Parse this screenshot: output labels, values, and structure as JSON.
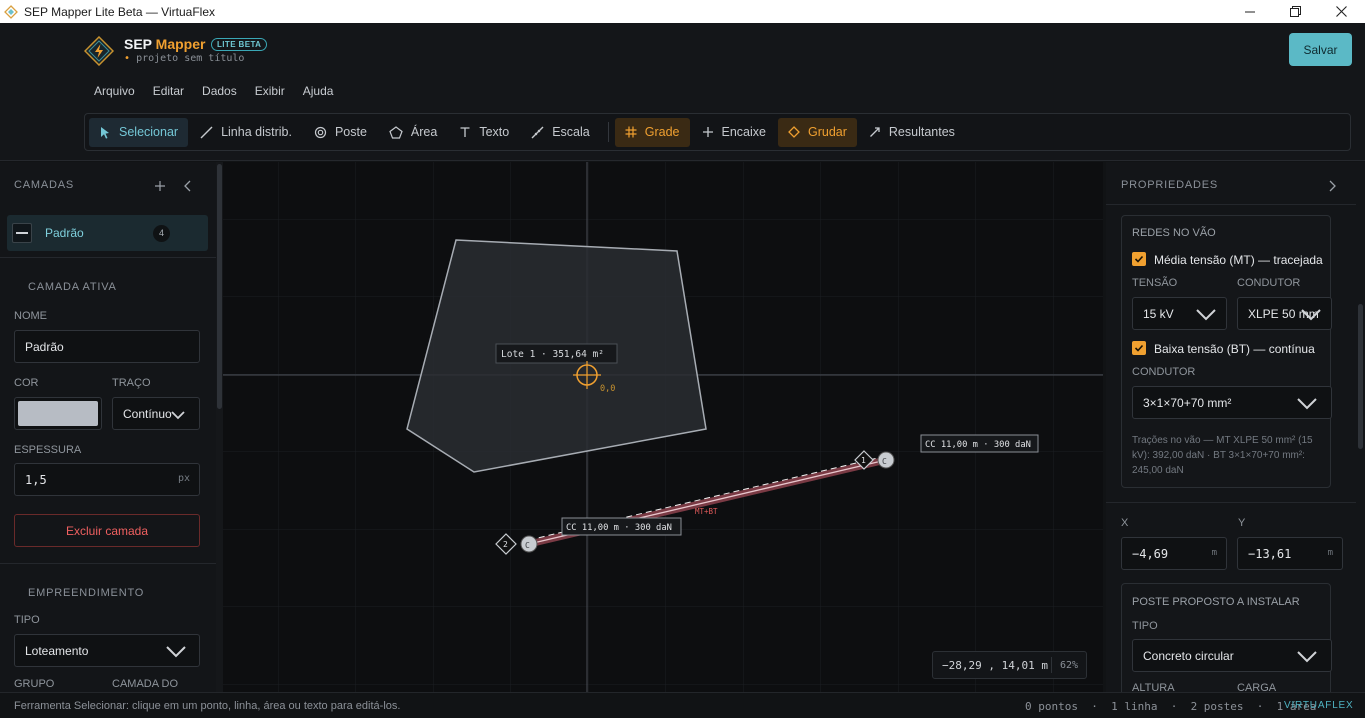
{
  "window": {
    "title": "SEP Mapper Lite Beta — VirtuaFlex"
  },
  "app": {
    "brand_main": "SEP",
    "brand_accent": "Mapper",
    "badge": "LITE BETA",
    "project_dot": "•",
    "project": "projeto sem título",
    "save_label": "Salvar",
    "accent_color": "#5bb9c6",
    "highlight_color": "#f0a030"
  },
  "menu": [
    "Arquivo",
    "Editar",
    "Dados",
    "Exibir",
    "Ajuda"
  ],
  "toolbar": {
    "select": "Selecionar",
    "line": "Linha distrib.",
    "pole": "Poste",
    "area": "Área",
    "text": "Texto",
    "scale": "Escala",
    "grid": "Grade",
    "snap": "Encaixe",
    "glue": "Grudar",
    "resultants": "Resultantes"
  },
  "layers": {
    "title": "CAMADAS",
    "items": [
      {
        "name": "Padrão",
        "count": "4"
      }
    ]
  },
  "active_layer": {
    "title": "CAMADA ATIVA",
    "name_label": "NOME",
    "name_value": "Padrão",
    "color_label": "COR",
    "color_value": "#b7bcc4",
    "stroke_label": "TRAÇO",
    "stroke_value": "Contínuo",
    "thickness_label": "ESPESSURA",
    "thickness_value": "1,5",
    "thickness_unit": "px",
    "delete_label": "Excluir camada"
  },
  "venture": {
    "title": "EMPREENDIMENTO",
    "type_label": "TIPO",
    "type_value": "Loteamento",
    "group_label": "GRUPO",
    "layer_label": "CAMADA DO"
  },
  "canvas": {
    "area_label": "Lote 1 · 351,64 m²",
    "origin_label": "0,0",
    "span_label_1": "CC 11,00 m · 300 daN",
    "span_label_2": "CC 11,00 m · 300 daN",
    "line_tag": "MT+BT",
    "pole_1": "1",
    "pole_2": "2",
    "pole_glyph": "C",
    "coords": "−28,29 , 14,01 m",
    "zoom": "62%"
  },
  "properties": {
    "title": "PROPRIEDADES",
    "networks_title": "REDES NO VÃO",
    "mt_label": "Média tensão (MT) — tracejada",
    "mt_checked": true,
    "voltage_label": "TENSÃO",
    "voltage_value": "15 kV",
    "conductor_label": "CONDUTOR",
    "conductor_value": "XLPE 50 mm",
    "bt_label": "Baixa tensão (BT) — contínua",
    "bt_checked": true,
    "bt_conductor_label": "CONDUTOR",
    "bt_conductor_value": "3×1×70+70 mm²",
    "traction_note": "Trações no vão — MT XLPE 50 mm² (15 kV): 392,00 daN · BT 3×1×70+70 mm²: 245,00 daN",
    "x_label": "X",
    "x_value": "−4,69",
    "y_label": "Y",
    "y_value": "−13,61",
    "unit_m": "m",
    "pole_title": "POSTE PROPOSTO A INSTALAR",
    "pole_type_label": "TIPO",
    "pole_type_value": "Concreto circular",
    "height_label": "ALTURA",
    "load_label": "CARGA"
  },
  "status": {
    "hint": "Ferramenta Selecionar: clique em um ponto, linha, área ou texto para editá-los.",
    "counts": "0 pontos  ·  1 linha  ·  2 postes  ·  1 área",
    "brand": "VIRTUAFLEX"
  }
}
